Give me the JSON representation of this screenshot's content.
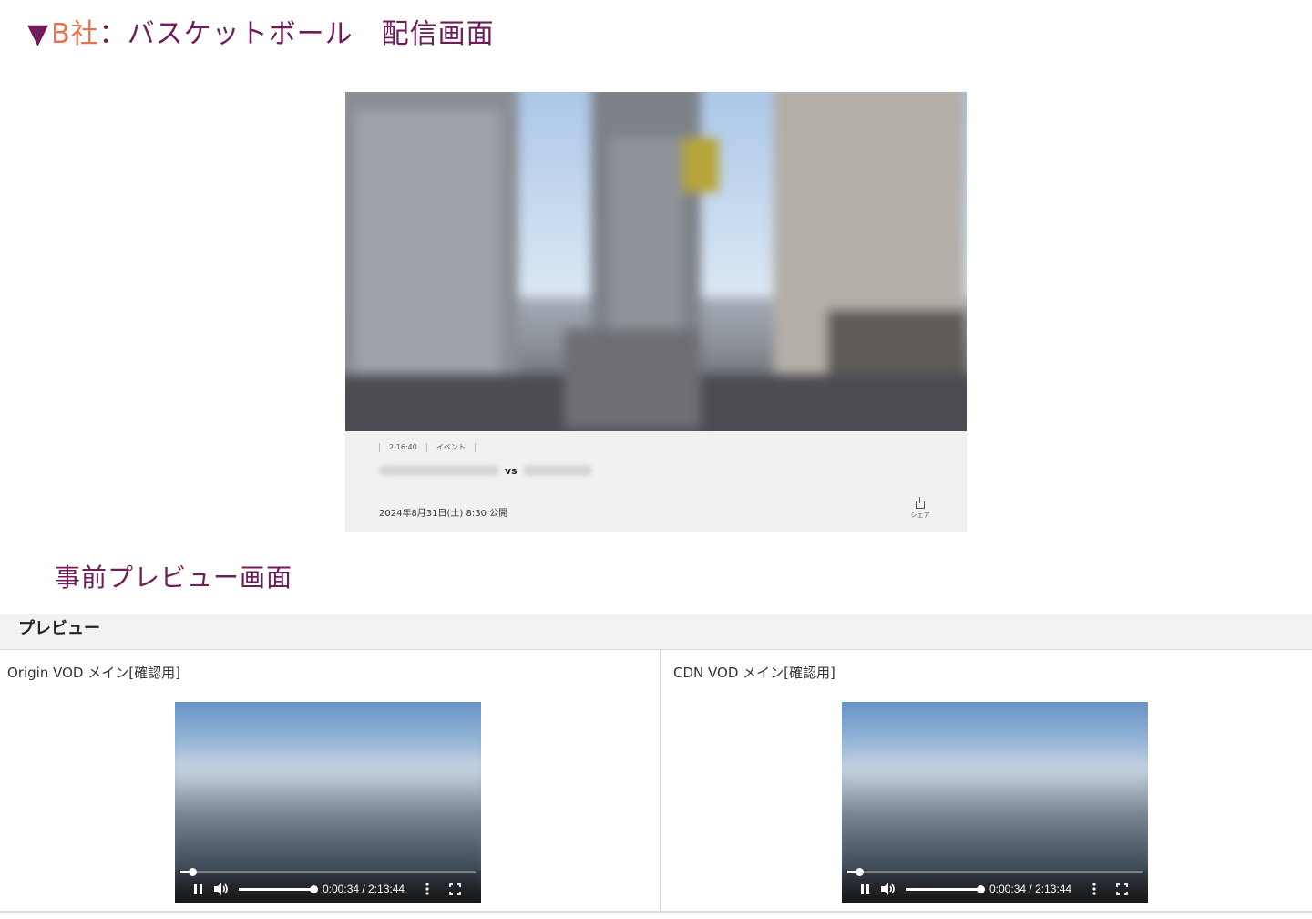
{
  "section_broadcast": {
    "triangle": "▼",
    "company": "B社",
    "title_rest": "：バスケットボール　配信画面"
  },
  "stream_card": {
    "duration": "2:16:40",
    "category": "イベント",
    "vs_label": "vs",
    "published": "2024年8月31日(土) 8:30 公開",
    "share_label": "シェア"
  },
  "section_preview": {
    "title": "事前プレビュー画面"
  },
  "preview_header": {
    "label": "プレビュー"
  },
  "players": [
    {
      "title": "Origin VOD メイン[確認用]",
      "time": "0:00:34 / 2:13:44",
      "progress": 0.04,
      "volume": 1.0
    },
    {
      "title": "CDN VOD メイン[確認用]",
      "time": "0:00:34 / 2:13:44",
      "progress": 0.04,
      "volume": 1.0
    }
  ],
  "colors": {
    "heading": "#6f1d5a",
    "company": "#e8714f",
    "card_bg": "#f1f1f1"
  }
}
